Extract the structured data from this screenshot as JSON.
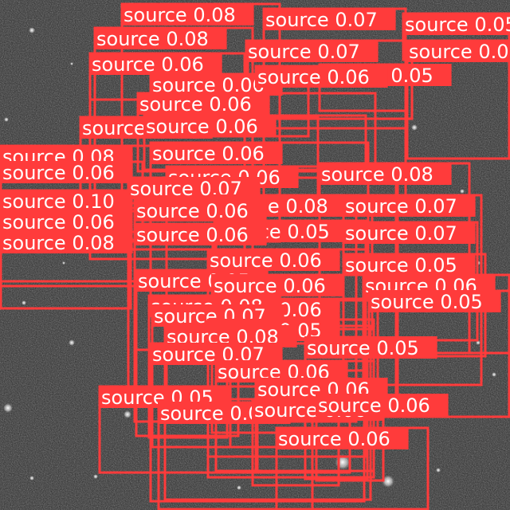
{
  "image": {
    "description_free": true,
    "box_color": "#ff3b3b",
    "label_text_color": "#ffffff",
    "background_tone": "#2a2a2a"
  },
  "detections": [
    {
      "label": "source",
      "score": "0.08"
    },
    {
      "label": "source",
      "score": "0.07"
    },
    {
      "label": "source",
      "score": "0.05"
    },
    {
      "label": "source",
      "score": "0.08"
    },
    {
      "label": "source",
      "score": "0.07"
    },
    {
      "label": "source",
      "score": "0.05"
    },
    {
      "label": "source",
      "score": "0.06"
    },
    {
      "label": "source",
      "score": "0.06"
    },
    {
      "label": "source",
      "score": "0.05"
    },
    {
      "label": "source",
      "score": "0.06"
    },
    {
      "label": "source",
      "score": "0.06"
    },
    {
      "label": "source",
      "score": "0.06"
    },
    {
      "label": "source",
      "score": "0.06"
    },
    {
      "label": "source",
      "score": "0.06"
    },
    {
      "label": "source",
      "score": "0.06"
    },
    {
      "label": "source",
      "score": "0.08"
    },
    {
      "label": "source",
      "score": "0.06"
    },
    {
      "label": "source",
      "score": "0.10"
    },
    {
      "label": "source",
      "score": "0.06"
    },
    {
      "label": "source",
      "score": "0.08"
    },
    {
      "label": "source",
      "score": "0.06"
    },
    {
      "label": "source",
      "score": "0.08"
    },
    {
      "label": "source",
      "score": "0.07"
    },
    {
      "label": "source",
      "score": "0.08"
    },
    {
      "label": "source",
      "score": "0.07"
    },
    {
      "label": "source",
      "score": "0.06"
    },
    {
      "label": "source",
      "score": "0.05"
    },
    {
      "label": "source",
      "score": "0.07"
    },
    {
      "label": "source",
      "score": "0.06"
    },
    {
      "label": "source",
      "score": "0.06"
    },
    {
      "label": "source",
      "score": "0.05"
    },
    {
      "label": "source",
      "score": "0.05"
    },
    {
      "label": "source",
      "score": "0.06"
    },
    {
      "label": "source",
      "score": "0.06"
    },
    {
      "label": "source",
      "score": "0.05"
    },
    {
      "label": "source",
      "score": "0.06"
    }
  ]
}
